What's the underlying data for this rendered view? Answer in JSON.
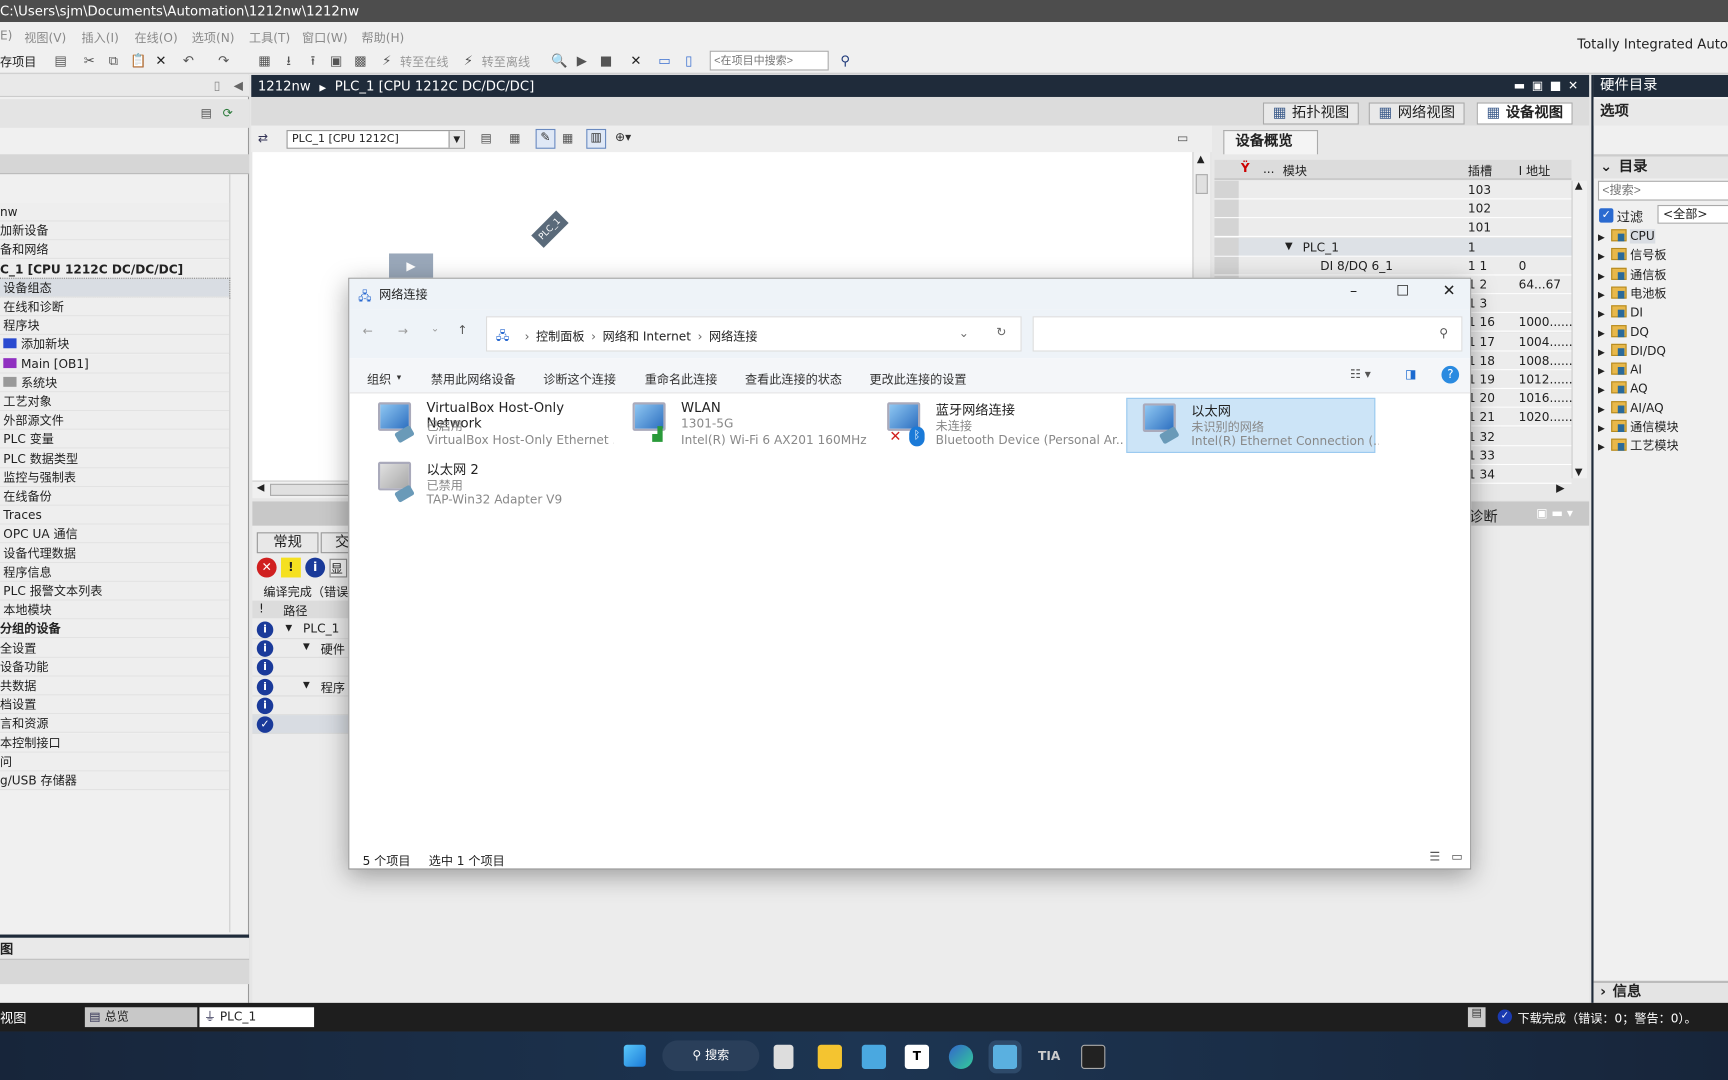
{
  "window": {
    "title": "C:\\Users\\sjm\\Documents\\Automation\\1212nw\\1212nw",
    "brand": "Totally Integrated Auto"
  },
  "menu": [
    "E)",
    "视图(V)",
    "插入(I)",
    "在线(O)",
    "选项(N)",
    "工具(T)",
    "窗口(W)",
    "帮助(H)"
  ],
  "toolbar": {
    "save_project": "存项目",
    "go_online": "转至在线",
    "go_offline": "转至离线",
    "search_placeholder": "<在项目中搜索>"
  },
  "left_tree": {
    "items": [
      {
        "label": "nw",
        "indent": 0
      },
      {
        "label": "加新设备",
        "indent": 0
      },
      {
        "label": "备和网络",
        "indent": 0
      },
      {
        "label": "C_1 [CPU 1212C DC/DC/DC]",
        "indent": 0,
        "bold": true
      },
      {
        "label": "设备组态",
        "indent": 1,
        "selected": true
      },
      {
        "label": "在线和诊断",
        "indent": 1
      },
      {
        "label": "程序块",
        "indent": 1
      },
      {
        "label": "添加新块",
        "indent": 2,
        "icon": "add-block-icon"
      },
      {
        "label": "Main [OB1]",
        "indent": 2,
        "icon": "ob-block-icon"
      },
      {
        "label": "系统块",
        "indent": 2,
        "icon": "system-block-icon"
      },
      {
        "label": "工艺对象",
        "indent": 1
      },
      {
        "label": "外部源文件",
        "indent": 1
      },
      {
        "label": "PLC 变量",
        "indent": 1
      },
      {
        "label": "PLC 数据类型",
        "indent": 1
      },
      {
        "label": "监控与强制表",
        "indent": 1
      },
      {
        "label": "在线备份",
        "indent": 1
      },
      {
        "label": "Traces",
        "indent": 1
      },
      {
        "label": "OPC UA 通信",
        "indent": 1
      },
      {
        "label": "设备代理数据",
        "indent": 1
      },
      {
        "label": "程序信息",
        "indent": 1
      },
      {
        "label": "PLC 报警文本列表",
        "indent": 1
      },
      {
        "label": "本地模块",
        "indent": 1
      },
      {
        "label": "分组的设备",
        "indent": 0,
        "bold": true
      },
      {
        "label": "全设置",
        "indent": 0
      },
      {
        "label": "设备功能",
        "indent": 0
      },
      {
        "label": "共数据",
        "indent": 0
      },
      {
        "label": "档设置",
        "indent": 0
      },
      {
        "label": "言和资源",
        "indent": 0
      },
      {
        "label": "本控制接口",
        "indent": 0
      },
      {
        "label": "问",
        "indent": 0
      },
      {
        "label": "g/USB 存储器",
        "indent": 0
      }
    ],
    "details_header": "图"
  },
  "editor": {
    "breadcrumb": [
      "1212nw",
      "PLC_1 [CPU 1212C DC/DC/DC]"
    ],
    "tabs": [
      {
        "label": "拓扑视图"
      },
      {
        "label": "网络视图"
      },
      {
        "label": "设备视图",
        "active": true
      }
    ],
    "device_select": "PLC_1 [CPU 1212C]",
    "canvas_device_label": "PLC_1"
  },
  "device_overview": {
    "tab": "设备概览",
    "columns": [
      "...",
      "模块",
      "插槽",
      "I 地址"
    ],
    "rows": [
      {
        "module": "",
        "slot": "103",
        "addr": ""
      },
      {
        "module": "",
        "slot": "102",
        "addr": ""
      },
      {
        "module": "",
        "slot": "101",
        "addr": ""
      },
      {
        "module": "PLC_1",
        "slot": "1",
        "addr": "",
        "expanded": true
      },
      {
        "module": "DI 8/DQ 6_1",
        "slot": "1 1",
        "addr": "0"
      },
      {
        "module": "",
        "slot": "1 2",
        "addr": "64...67"
      },
      {
        "module": "",
        "slot": "1 3",
        "addr": ""
      },
      {
        "module": "",
        "slot": "1 16",
        "addr": "1000......"
      },
      {
        "module": "",
        "slot": "1 17",
        "addr": "1004......"
      },
      {
        "module": "",
        "slot": "1 18",
        "addr": "1008......"
      },
      {
        "module": "",
        "slot": "1 19",
        "addr": "1012......"
      },
      {
        "module": "",
        "slot": "1 20",
        "addr": "1016......"
      },
      {
        "module": "",
        "slot": "1 21",
        "addr": "1020......"
      },
      {
        "module": "",
        "slot": "1 32",
        "addr": ""
      },
      {
        "module": "",
        "slot": "1 33",
        "addr": ""
      },
      {
        "module": "",
        "slot": "1 34",
        "addr": ""
      }
    ]
  },
  "inspector": {
    "tabs": [
      "常规",
      "交"
    ],
    "show_btn": "显",
    "message": "编译完成（错误",
    "col_bang": "!",
    "col_path": "路径",
    "rows": [
      {
        "icon": "info",
        "text": "PLC_1",
        "level": 0,
        "arrow": true
      },
      {
        "icon": "info",
        "text": "硬件",
        "level": 1,
        "arrow": true
      },
      {
        "icon": "info",
        "text": ""
      },
      {
        "icon": "info",
        "text": "程序",
        "level": 1,
        "arrow": true
      },
      {
        "icon": "info",
        "text": ""
      },
      {
        "icon": "check",
        "text": ""
      }
    ],
    "diag_tab": "诊断"
  },
  "catalog": {
    "header": "硬件目录",
    "options": "选项",
    "section": "目录",
    "search_placeholder": "<搜索>",
    "filter_label": "过滤",
    "filter_checked": true,
    "filter_value": "<全部>",
    "items": [
      "CPU",
      "信号板",
      "通信板",
      "电池板",
      "DI",
      "DQ",
      "DI/DQ",
      "AI",
      "AQ",
      "AI/AQ",
      "通信模块",
      "工艺模块"
    ],
    "info": "信息"
  },
  "statusbar": {
    "portal_view": "视图",
    "tabs": [
      {
        "label": "总览"
      },
      {
        "label": "PLC_1",
        "active": true
      }
    ],
    "status": "下载完成（错误：0；警告：0）。"
  },
  "taskbar": {
    "search": "搜索",
    "apps": [
      "windows-start",
      "task-view",
      "file-explorer",
      "remote-desktop",
      "typora",
      "edge",
      "network-control",
      "tia-portal-v17",
      "camera"
    ]
  },
  "dialog": {
    "title": "网络连接",
    "path": [
      "控制面板",
      "网络和 Internet",
      "网络连接"
    ],
    "search_placeholder": "",
    "commands": [
      "组织",
      "禁用此网络设备",
      "诊断这个连接",
      "重命名此连接",
      "查看此连接的状态",
      "更改此连接的设置"
    ],
    "connections": [
      {
        "name": "VirtualBox Host-Only Network",
        "status": "已启用",
        "device": "VirtualBox Host-Only Ethernet ...",
        "badge": "cable"
      },
      {
        "name": "WLAN",
        "status": "1301-5G",
        "device": "Intel(R) Wi-Fi 6 AX201 160MHz",
        "badge": "signal"
      },
      {
        "name": "蓝牙网络连接",
        "status": "未连接",
        "device": "Bluetooth Device (Personal Ar...",
        "badge": "bluetooth"
      },
      {
        "name": "以太网",
        "status": "未识别的网络",
        "device": "Intel(R) Ethernet Connection (...",
        "badge": "cable",
        "selected": true
      },
      {
        "name": "以太网 2",
        "status": "已禁用",
        "device": "TAP-Win32 Adapter V9",
        "badge": "cable",
        "disabled": true
      }
    ],
    "item_count": "5 个项目",
    "selected_count": "选中 1 个项目"
  },
  "colors": {
    "tia_dark": "#1f2b3a",
    "selection": "#cce4f7",
    "info_blue": "#1a3a9a",
    "taskbar": "#1d3552"
  }
}
